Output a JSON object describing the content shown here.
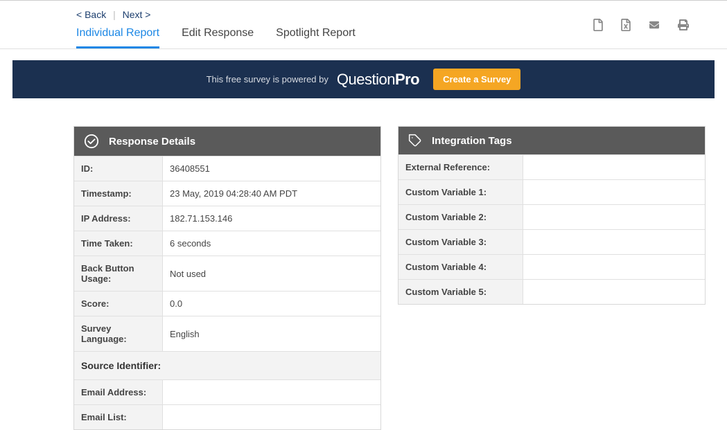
{
  "nav": {
    "back": "< Back",
    "next": "Next >",
    "separator": "|",
    "tabs": [
      "Individual Report",
      "Edit Response",
      "Spotlight Report"
    ]
  },
  "banner": {
    "powered": "This free survey is powered by",
    "brand_light": "Question",
    "brand_bold": "Pro",
    "cta": "Create a Survey"
  },
  "response": {
    "title": "Response Details",
    "rows": [
      {
        "label": "ID:",
        "value": "36408551"
      },
      {
        "label": "Timestamp:",
        "value": "23 May, 2019 04:28:40 AM PDT"
      },
      {
        "label": "IP Address:",
        "value": "182.71.153.146"
      },
      {
        "label": "Time Taken:",
        "value": "6 seconds"
      },
      {
        "label": "Back Button Usage:",
        "value": "Not used"
      },
      {
        "label": "Score:",
        "value": "0.0"
      },
      {
        "label": "Survey Language:",
        "value": "English"
      }
    ],
    "source_identifier": "Source Identifier:",
    "source_rows": [
      {
        "label": "Email Address:",
        "value": ""
      },
      {
        "label": "Email List:",
        "value": ""
      }
    ]
  },
  "tags": {
    "title": "Integration Tags",
    "rows": [
      {
        "label": "External Reference:",
        "value": ""
      },
      {
        "label": "Custom Variable 1:",
        "value": ""
      },
      {
        "label": "Custom Variable 2:",
        "value": ""
      },
      {
        "label": "Custom Variable 3:",
        "value": ""
      },
      {
        "label": "Custom Variable 4:",
        "value": ""
      },
      {
        "label": "Custom Variable 5:",
        "value": ""
      }
    ]
  }
}
